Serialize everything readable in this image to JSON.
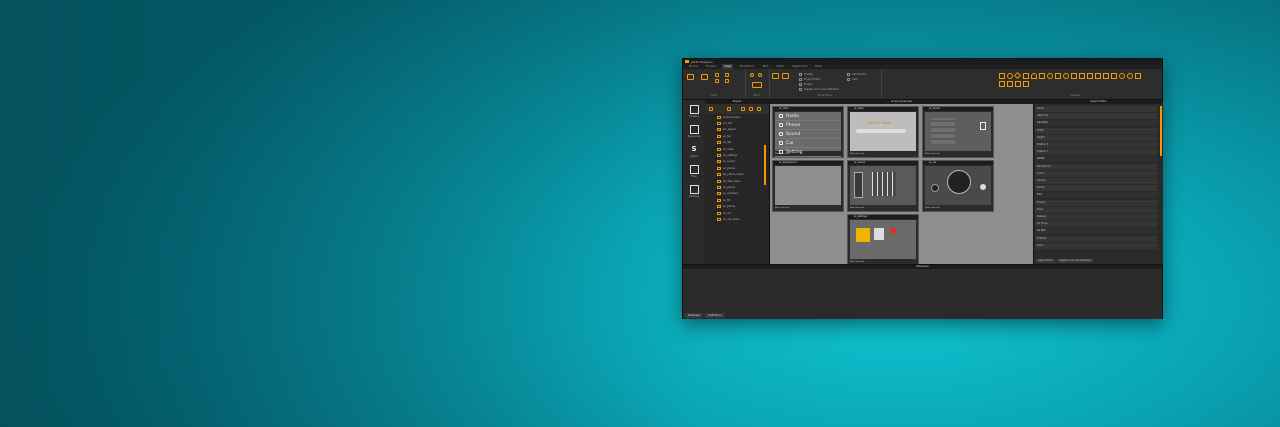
{
  "app": {
    "title": "jaVIS Designer",
    "tabs": [
      "Home",
      "Project",
      "View",
      "Transform",
      "Text",
      "Tools",
      "Alignment",
      "Help"
    ],
    "active_tab": "View",
    "ribbon_groups": [
      "Align",
      "Zoom",
      "Show Items",
      "Shapes"
    ],
    "show_items": [
      "Toolbar",
      "Project Editor",
      "Project",
      "Toggles and Lines Definition",
      "Result",
      "Guide Template",
      "Information",
      "Help"
    ]
  },
  "rail": [
    {
      "label": "Screens",
      "icon": "monitor-icon"
    },
    {
      "label": "Resources",
      "icon": "document-icon"
    },
    {
      "label": "Styles",
      "icon": "styles-icon"
    },
    {
      "label": "Files",
      "icon": "files-icon"
    },
    {
      "label": "Settings",
      "icon": "settings-icon"
    }
  ],
  "project": {
    "title": "Project",
    "items": [
      "screens.menu",
      "scr_list",
      "scr_player",
      "ac_fan",
      "ac_led",
      "ac_radio",
      "ac_settings",
      "ac_sound",
      "ac_phone",
      "ph_phone_menu",
      "ph_dial_menu",
      "ac_phone",
      "ac_numpad",
      "ac_fill",
      "ac_phone",
      "ac_car",
      "ac_call_menu"
    ]
  },
  "canvas": {
    "title": "Screen Overview",
    "screens": [
      {
        "name": "ac_main"
      },
      {
        "name": "ac_radio"
      },
      {
        "name": "ac_phone"
      },
      {
        "name": "ac_background"
      },
      {
        "name": "ac_sound"
      },
      {
        "name": "ac_car"
      },
      {
        "name": "ac_settings"
      }
    ],
    "menu_items": [
      "Radio",
      "Phone",
      "Sound",
      "Car",
      "Setting"
    ],
    "radio_text": "FM 98.5 Radio",
    "footer": "Main item title"
  },
  "properties": {
    "title": "Object Editor",
    "rows": [
      "Name",
      "Object ID",
      "Geometry",
      "Width",
      "Height",
      "Position X",
      "Position Y",
      "Visible",
      "Background",
      "Colors",
      "Opacity",
      "Border",
      "Font",
      "Events",
      "Press",
      "Release",
      "On Focus",
      "On Blur",
      "Enabled",
      "Style"
    ],
    "tabs": [
      "Object Editor",
      "Toggles and Lines Definition"
    ]
  },
  "messages": {
    "title": "Messages",
    "tabs": [
      "Messages",
      "Definitions"
    ]
  },
  "colors": {
    "accent": "#f39a00",
    "panel": "#262626",
    "canvas_bg": "#8e8e8e"
  }
}
